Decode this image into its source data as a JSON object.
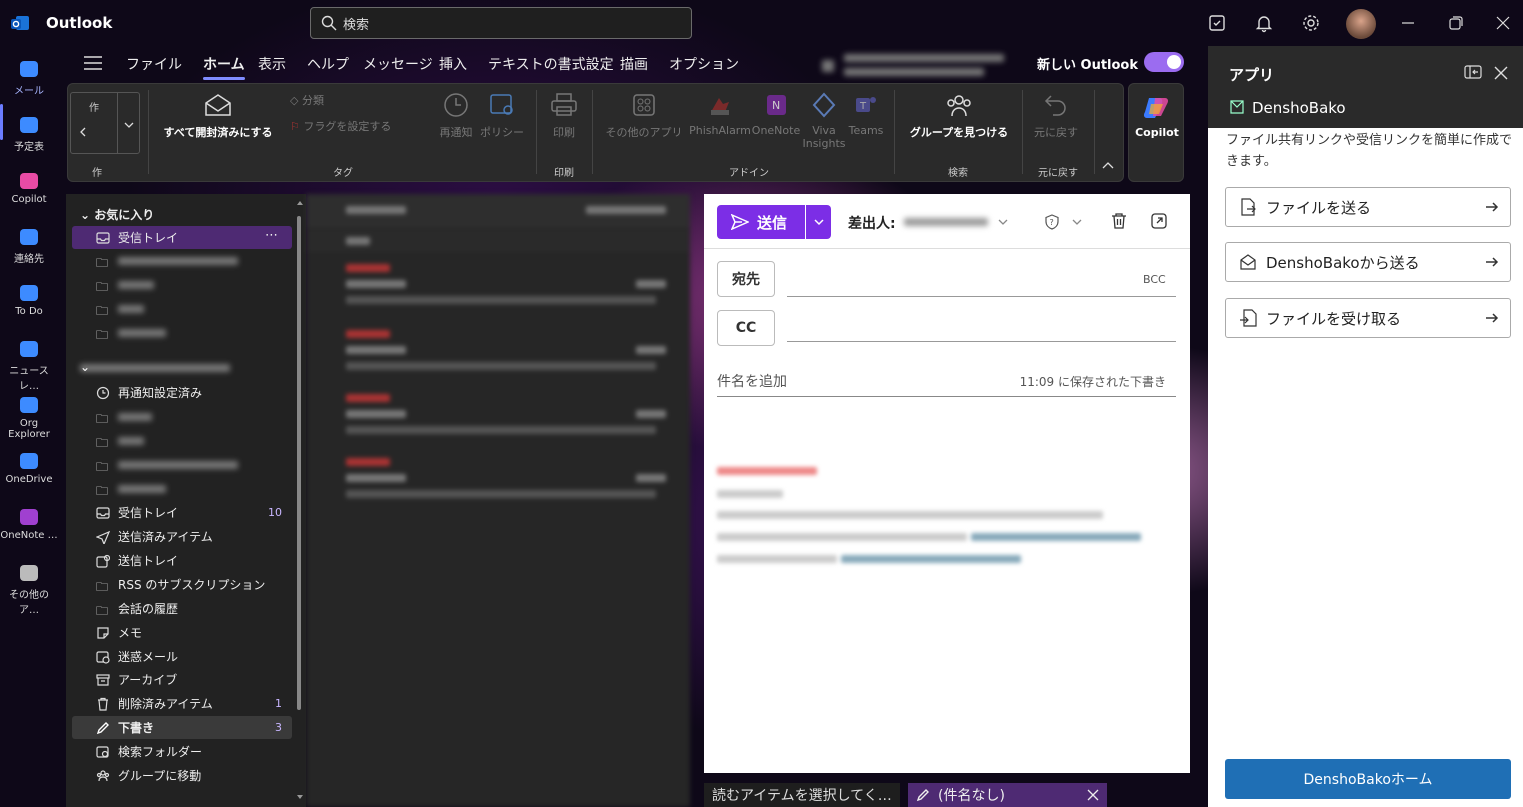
{
  "titlebar": {
    "app_name": "Outlook",
    "search_placeholder": "検索"
  },
  "leftnav": [
    {
      "label": "メール",
      "icon": "mail-icon"
    },
    {
      "label": "予定表",
      "icon": "calendar-icon"
    },
    {
      "label": "Copilot",
      "icon": "copilot-icon"
    },
    {
      "label": "連絡先",
      "icon": "people-icon"
    },
    {
      "label": "To Do",
      "icon": "todo-icon"
    },
    {
      "label": "ニュースレ…",
      "icon": "newsletter-icon"
    },
    {
      "label": "Org Explorer",
      "icon": "org-explorer-icon"
    },
    {
      "label": "OneDrive",
      "icon": "onedrive-icon"
    },
    {
      "label": "OneNote …",
      "icon": "onenote-icon"
    },
    {
      "label": "その他のア…",
      "icon": "more-apps-icon"
    }
  ],
  "menubar": {
    "tabs": [
      "ファイル",
      "ホーム",
      "表示",
      "ヘルプ",
      "メッセージ",
      "挿入",
      "テキストの書式設定",
      "描画",
      "オプション"
    ],
    "new_outlook_label": "新しい Outlook",
    "new_outlook_enabled": true
  },
  "ribbon": {
    "mark_all_read": "すべて開封済みにする",
    "categorize": "分類",
    "set_flag": "フラグを設定する",
    "tag_group": "タグ",
    "snooze": "再通知",
    "policy": "ポリシー",
    "print": "印刷",
    "print_group": "印刷",
    "other_apps": "その他のアプリ",
    "phishalarm": "PhishAlarm",
    "onenote": "OneNote",
    "viva_insights": "Viva Insights",
    "teams": "Teams",
    "addin_group": "アドイン",
    "find_groups": "グループを見つける",
    "search_group": "検索",
    "undo": "元に戻す",
    "undo_group": "元に戻す",
    "copilot": "Copilot",
    "left_group_fragment": "作"
  },
  "folders": {
    "favorites_header": "お気に入り",
    "favorites_inbox": "受信トレイ",
    "snoozed": "再通知設定済み",
    "inbox": "受信トレイ",
    "inbox_count": "10",
    "sent": "送信済みアイテム",
    "outbox": "送信トレイ",
    "rss": "RSS のサブスクリプション",
    "conversation_history": "会話の履歴",
    "notes": "メモ",
    "junk": "迷惑メール",
    "archive": "アーカイブ",
    "deleted": "削除済みアイテム",
    "deleted_count": "1",
    "drafts": "下書き",
    "drafts_count": "3",
    "search_folders": "検索フォルダー",
    "go_to_groups": "グループに移動"
  },
  "compose": {
    "send_label": "送信",
    "from_label": "差出人:",
    "to_label": "宛先",
    "bcc_label": "BCC",
    "cc_label": "CC",
    "subject_placeholder": "件名を追加",
    "saved_status": "11:09 に保存された下書き"
  },
  "app_pane": {
    "title": "アプリ",
    "app_name": "DenshoBako",
    "description": "ファイル共有リンクや受信リンクを簡単に作成できます。",
    "actions": [
      {
        "label": "ファイルを送る",
        "icon": "send-file-icon"
      },
      {
        "label": "DenshoBakoから送る",
        "icon": "denshobako-send-icon"
      },
      {
        "label": "ファイルを受け取る",
        "icon": "receive-file-icon"
      }
    ],
    "home_button": "DenshoBakoホーム"
  },
  "bottom_tabs": {
    "reading": "読むアイテムを選択してく…",
    "draft": "(件名なし)"
  },
  "colors": {
    "accent": "#7c2ee6",
    "selection": "#4e2a73",
    "app_button": "#1f6fb5"
  }
}
